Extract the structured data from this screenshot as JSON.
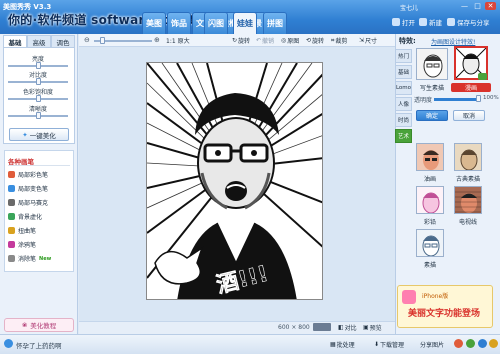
{
  "app": {
    "brand": "美图秀秀 V3.3",
    "watermark": "你的·软件频道 software.it168.com",
    "tabs": [
      "美图",
      "饰品",
      "文字",
      "边框",
      "场景",
      "闪图",
      "娃娃",
      "拼图"
    ],
    "active_tab": "娃娃",
    "user": "宝七儿",
    "win_controls": [
      "—",
      "□",
      "✕"
    ],
    "actions": [
      {
        "label": "打开",
        "icon": "folder-icon"
      },
      {
        "label": "新建",
        "icon": "new-file-icon"
      },
      {
        "label": "保存与分享",
        "icon": "save-icon"
      }
    ]
  },
  "left": {
    "tabs": [
      "基础",
      "高级",
      "调色"
    ],
    "active": "基础",
    "sliders": [
      {
        "label": "亮度",
        "value": 0.5
      },
      {
        "label": "对比度",
        "value": 0.5
      },
      {
        "label": "色彩饱和度",
        "value": 0.5
      },
      {
        "label": "清晰度",
        "value": 0.5
      }
    ],
    "one_click": "一键美化",
    "brushes_title": "各种画笔",
    "brushes": [
      {
        "label": "局部彩色笔",
        "color": "#e05c3a"
      },
      {
        "label": "局部变色笔",
        "color": "#3a8fe0"
      },
      {
        "label": "局部马赛克",
        "color": "#6a6a6a"
      },
      {
        "label": "背景虚化",
        "color": "#3aa55a"
      },
      {
        "label": "扭曲笔",
        "color": "#d9a21f"
      },
      {
        "label": "涂鸦笔",
        "color": "#c43a9c"
      },
      {
        "label": "消除笔",
        "color": "#8a8a8a",
        "badge": "New"
      }
    ],
    "tutorial": "美化教程"
  },
  "toolbar": {
    "zoom_label": "1:1 原大",
    "tools": [
      {
        "label": "旋转",
        "icon": "rotate-icon",
        "enabled": true
      },
      {
        "label": "撤销",
        "icon": "undo-icon",
        "enabled": true
      },
      {
        "label": "重做",
        "icon": "redo-icon",
        "enabled": false
      },
      {
        "label": "原图",
        "icon": "original-icon",
        "enabled": true
      },
      {
        "label": "旋转",
        "icon": "rotate-icon",
        "enabled": true
      },
      {
        "label": "裁剪",
        "icon": "crop-icon",
        "enabled": true
      },
      {
        "label": "尺寸",
        "icon": "resize-icon",
        "enabled": true
      }
    ]
  },
  "canvas": {
    "size": "600 × 800",
    "caption": "酒!!!",
    "compare": "对比",
    "preview": "预览"
  },
  "right": {
    "title": "特效:",
    "link": "为画图设计特效!",
    "side_tabs": [
      "热门",
      "基础",
      "Lomo",
      "人像",
      "时尚",
      "艺术"
    ],
    "active_side_tab": "艺术",
    "top_effects": [
      {
        "label": "写生素描"
      },
      {
        "label": "漫画"
      }
    ],
    "opacity_label": "透明度",
    "opacity_value": "100%",
    "opacity": 1.0,
    "confirm": "确定",
    "cancel": "取消",
    "effects": [
      {
        "label": "油画"
      },
      {
        "label": "古典素描"
      },
      {
        "label": "彩铅"
      },
      {
        "label": "电视线"
      },
      {
        "label": "素描"
      }
    ],
    "ad_line1": "iPhone版",
    "ad_line2": "美丽文字功能登场"
  },
  "status": {
    "left": "怀孕了上药药啊",
    "batch": "批处理",
    "download": "下载管理",
    "share": "分享图片"
  },
  "colors": {
    "accent": "#2f7fd2",
    "active_green": "#4aa23a",
    "highlight_red": "#d9322c"
  }
}
